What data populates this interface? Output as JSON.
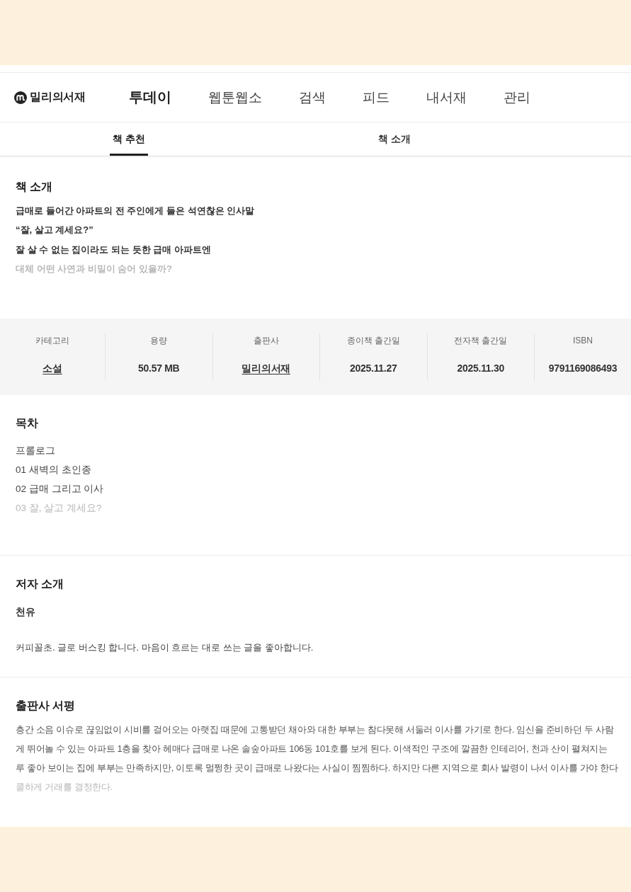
{
  "header": {
    "logo": {
      "name": "밀리의서재"
    },
    "nav": [
      {
        "label": "투데이",
        "selected": true
      },
      {
        "label": "웹툰웹소",
        "selected": false
      },
      {
        "label": "검색",
        "selected": false
      },
      {
        "label": "피드",
        "selected": false
      },
      {
        "label": "내서재",
        "selected": false
      },
      {
        "label": "관리",
        "selected": false
      }
    ]
  },
  "sub_tabs": [
    {
      "label": "책 추천",
      "selected": true
    },
    {
      "label": "책 소개",
      "selected": false
    }
  ],
  "book_intro": {
    "title": "책 소개",
    "collapsed": true,
    "lines": [
      "급매로 들어간 아파트의 전 주인에게 들은 석연찮은 인사말",
      "“잘, 살고 계세요?”",
      "잘 살 수 없는 집이라도 되는 듯한 급매 아파트엔",
      "대체 어떤 사연과 비밀이 숨어 있을까?"
    ]
  },
  "info": [
    {
      "label": "카테고리",
      "value": "소설",
      "kind": "link"
    },
    {
      "label": "용량",
      "value": "50.57 MB",
      "kind": "text"
    },
    {
      "label": "출판사",
      "value": "밀리의서재",
      "kind": "link"
    },
    {
      "label": "종이책 출간일",
      "value": "2025.11.27",
      "kind": "text"
    },
    {
      "label": "전자책 출간일",
      "value": "2025.11.30",
      "kind": "text"
    },
    {
      "label": "ISBN",
      "value": "9791169086493",
      "kind": "text"
    }
  ],
  "toc": {
    "title": "목차",
    "collapsed": true,
    "items": [
      "프롤로그",
      "01 새벽의 초인종",
      "02 급매 그리고 이사",
      "03 잘, 살고 계세요?"
    ]
  },
  "author": {
    "title": "저자 소개",
    "name": "천유",
    "bio": "커피꼴초. 글로 버스킹 합니다. 마음이 흐르는 대로 쓰는 글을 좋아합니다."
  },
  "publisher_review": {
    "title": "출판사 서평",
    "collapsed": true,
    "lines": [
      "층간 소음 이슈로 끊임없이 시비를 걸어오는 아랫집 때문에 고통받던 채아와 대한 부부는 참다못해 서둘러 이사를 가기로 한다. 임신을 준비하던 두 사람",
      "게 뛰어놀 수 있는 아파트 1층을 찾아 헤매다 급매로 나온 솔숲아파트 106동 101호를 보게 된다. 이색적인 구조에 깔끔한 인테리어, 천과 산이 펼쳐지는",
      "루 좋아 보이는 집에 부부는 만족하지만, 이토록 멀쩡한 곳이 급매로 나왔다는 사실이 찜찜하다. 하지만 다른 지역으로 회사 발령이 나서 이사를 가야 한다",
      "쿨하게 거래를 결정한다."
    ]
  }
}
